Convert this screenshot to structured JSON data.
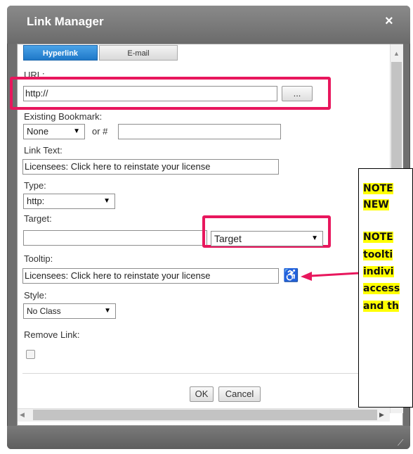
{
  "dialog": {
    "title": "Link Manager",
    "close_glyph": "×"
  },
  "tabs": [
    {
      "label": "Hyperlink",
      "active": true
    },
    {
      "label": "E-mail",
      "active": false
    }
  ],
  "form": {
    "url_label": "URL:",
    "url_value": "http://",
    "browse_label": "...",
    "bookmark_label": "Existing Bookmark:",
    "bookmark_value": "None",
    "or_hash": "or #",
    "link_text_label": "Link Text:",
    "link_text_value": "Licensees: Click here to reinstate your license",
    "type_label": "Type:",
    "type_value": "http:",
    "target_label": "Target:",
    "target_select_value": "Target",
    "tooltip_label": "Tooltip:",
    "tooltip_value": "Licensees: Click here to reinstate your license",
    "style_label": "Style:",
    "style_value": "No Class",
    "remove_link_label": "Remove Link:"
  },
  "buttons": {
    "ok": "OK",
    "cancel": "Cancel"
  },
  "note": {
    "line1": "NOTE",
    "line2": "NEW",
    "line3": "NOTE",
    "line4": "toolti",
    "line5": "indivi",
    "line6": "access",
    "line7": "and th"
  },
  "icons": {
    "accessibility": "wheelchair-icon",
    "arrow": "arrow-left-icon",
    "dropdown": "triangle-down-icon"
  },
  "colors": {
    "highlight": "#e8175d",
    "note_highlight": "#ffff00",
    "active_tab": "#2b86d6"
  }
}
